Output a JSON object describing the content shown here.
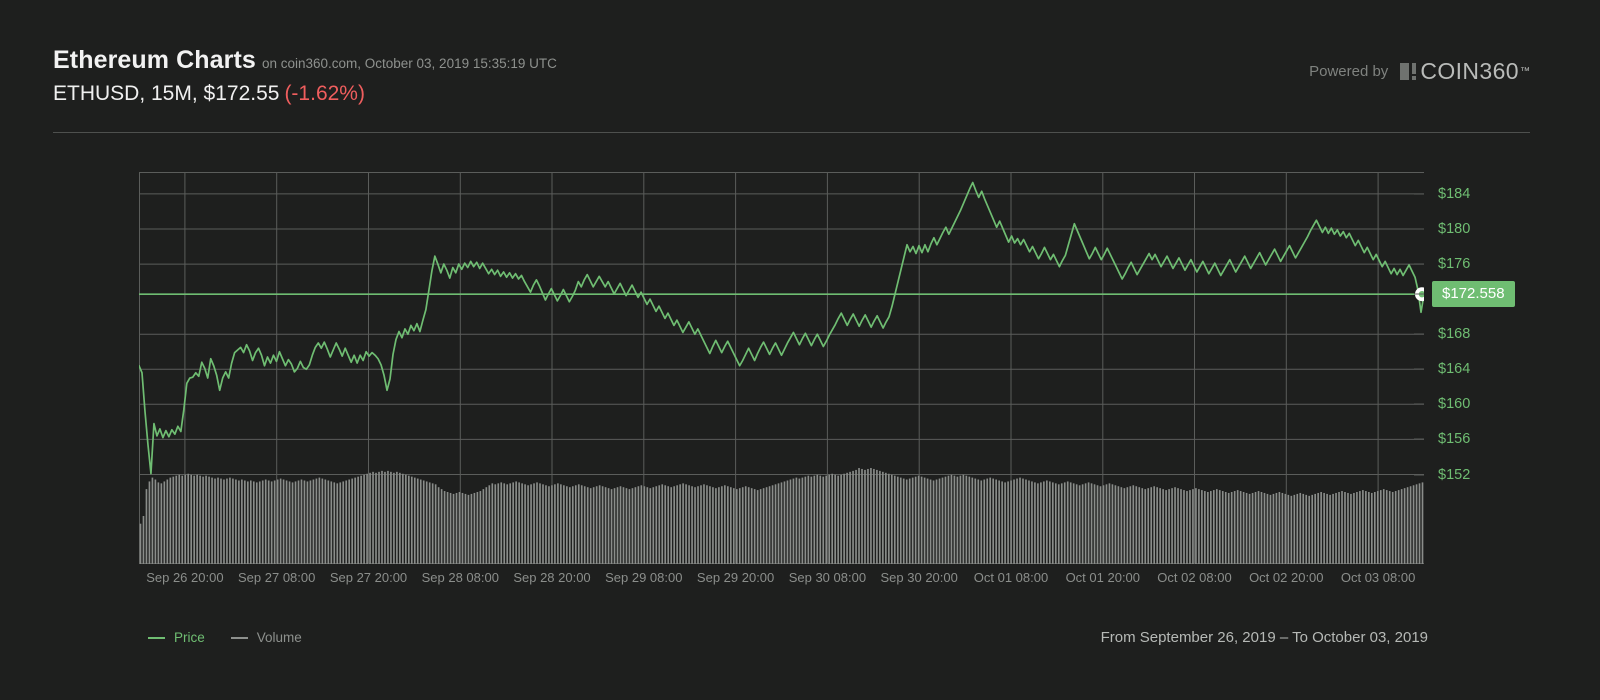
{
  "header": {
    "title": "Ethereum Charts",
    "source_line": "on coin360.com, October 03, 2019 15:35:19 UTC",
    "pair_line": "ETHUSD, 15M, $172.55",
    "change": "(-1.62%)",
    "powered_by": "Powered by",
    "brand": "COIN360",
    "brand_tm": "™"
  },
  "legend": {
    "price_label": "Price",
    "volume_label": "Volume",
    "price_color": "#6fbd72",
    "volume_color": "#8d908d"
  },
  "footer": {
    "range": "From September 26, 2019 – To October 03, 2019"
  },
  "colors": {
    "background": "#1e1f1e",
    "grid": "#5b5d5b",
    "price_line": "#6fbd72",
    "volume_bar": "#8a8d8a",
    "change_negative": "#ef5e5e",
    "axis_text": "#8b8e8b",
    "badge_bg": "#6fbd72",
    "badge_text": "#ffffff"
  },
  "chart_data": {
    "type": "line",
    "title": "Ethereum Charts",
    "subtitle": "ETHUSD, 15M, $172.55 (-1.62%)",
    "xlabel": "",
    "ylabel": "",
    "grid": true,
    "legend_position": "bottom-left",
    "ylim": [
      150,
      186.5
    ],
    "yticks": [
      184,
      180,
      176,
      172.558,
      168,
      164,
      160,
      156,
      152
    ],
    "ytick_labels": [
      "$184",
      "$180",
      "$176",
      "$172.558",
      "$168",
      "$164",
      "$160",
      "$156",
      "$152"
    ],
    "current_price_line": 172.558,
    "current_price_label": "$172.558",
    "xtick_labels": [
      "Sep 26 20:00",
      "Sep 27 08:00",
      "Sep 27 20:00",
      "Sep 28 08:00",
      "Sep 28 20:00",
      "Sep 29 08:00",
      "Sep 29 20:00",
      "Sep 30 08:00",
      "Sep 30 20:00",
      "Oct 01 08:00",
      "Oct 01 20:00",
      "Oct 02 08:00",
      "Oct 02 20:00",
      "Oct 03 08:00"
    ],
    "series": [
      {
        "name": "Price",
        "unit": "USD",
        "color": "#6fbd72",
        "values": [
          164.4,
          163.6,
          159.2,
          155.4,
          152.1,
          157.8,
          156.4,
          157.2,
          156.2,
          157.0,
          156.3,
          157.1,
          156.6,
          157.5,
          156.9,
          159.4,
          162.4,
          163.0,
          163.1,
          163.6,
          163.2,
          164.8,
          164.1,
          163.0,
          165.2,
          164.4,
          163.3,
          161.6,
          163.0,
          163.7,
          163.0,
          164.7,
          165.9,
          166.2,
          166.5,
          165.9,
          166.8,
          166.1,
          165.0,
          165.9,
          166.4,
          165.6,
          164.4,
          165.4,
          164.7,
          165.6,
          164.9,
          166.0,
          165.2,
          164.4,
          165.1,
          164.6,
          163.7,
          164.1,
          164.9,
          164.2,
          164.0,
          164.5,
          165.6,
          166.5,
          167.0,
          166.4,
          167.1,
          166.3,
          165.4,
          166.2,
          167.0,
          166.3,
          165.5,
          166.4,
          165.6,
          164.8,
          165.6,
          164.7,
          165.6,
          165.0,
          166.0,
          165.5,
          165.9,
          165.6,
          165.2,
          164.5,
          163.3,
          161.6,
          162.9,
          165.7,
          167.4,
          168.3,
          167.6,
          168.6,
          168.0,
          169.0,
          168.4,
          169.2,
          168.3,
          169.6,
          170.8,
          173.0,
          175.2,
          176.9,
          176.0,
          175.0,
          176.0,
          175.3,
          174.4,
          175.6,
          175.0,
          176.0,
          175.4,
          176.1,
          175.6,
          176.3,
          175.7,
          176.2,
          175.5,
          176.1,
          175.5,
          174.9,
          175.4,
          174.8,
          175.3,
          174.6,
          175.1,
          174.5,
          175.0,
          174.4,
          174.9,
          174.3,
          174.7,
          174.0,
          173.4,
          172.8,
          173.6,
          174.2,
          173.5,
          172.7,
          171.9,
          172.6,
          173.2,
          172.5,
          171.8,
          172.4,
          173.1,
          172.4,
          171.7,
          172.3,
          173.0,
          174.0,
          173.4,
          174.2,
          174.8,
          174.1,
          173.4,
          174.0,
          174.6,
          174.0,
          173.4,
          174.0,
          173.3,
          172.6,
          173.2,
          173.8,
          173.1,
          172.4,
          173.0,
          173.6,
          172.9,
          172.2,
          172.8,
          172.1,
          171.4,
          172.0,
          171.3,
          170.6,
          171.2,
          170.5,
          169.8,
          170.4,
          169.7,
          169.0,
          169.6,
          168.9,
          168.2,
          168.8,
          169.4,
          168.7,
          168.0,
          168.6,
          167.9,
          167.2,
          166.5,
          165.8,
          166.6,
          167.3,
          166.6,
          165.9,
          166.6,
          167.2,
          166.5,
          165.8,
          165.1,
          164.4,
          165.0,
          165.7,
          166.4,
          165.7,
          165.0,
          165.8,
          166.5,
          167.1,
          166.4,
          165.7,
          166.4,
          167.0,
          166.3,
          165.6,
          166.3,
          167.0,
          167.6,
          168.2,
          167.5,
          166.8,
          167.5,
          168.1,
          167.4,
          166.7,
          167.4,
          168.0,
          167.3,
          166.6,
          167.2,
          167.9,
          168.5,
          169.1,
          169.8,
          170.4,
          169.7,
          169.0,
          169.7,
          170.3,
          169.6,
          168.9,
          169.6,
          170.2,
          169.5,
          168.8,
          169.5,
          170.1,
          169.4,
          168.7,
          169.4,
          170.0,
          171.2,
          172.6,
          174.0,
          175.4,
          176.8,
          178.2,
          177.4,
          178.0,
          177.2,
          178.1,
          177.3,
          178.2,
          177.4,
          178.3,
          179.0,
          178.2,
          178.9,
          179.6,
          180.2,
          179.4,
          180.1,
          180.8,
          181.5,
          182.2,
          183.0,
          183.8,
          184.6,
          185.3,
          184.4,
          183.6,
          184.3,
          183.4,
          182.6,
          181.8,
          181.0,
          180.2,
          180.9,
          180.1,
          179.3,
          178.5,
          179.2,
          178.4,
          178.9,
          178.2,
          178.8,
          178.1,
          177.4,
          178.0,
          177.3,
          176.6,
          177.2,
          177.9,
          177.2,
          176.5,
          177.1,
          176.4,
          175.7,
          176.4,
          177.0,
          178.2,
          179.4,
          180.6,
          179.8,
          179.0,
          178.2,
          177.4,
          176.6,
          177.2,
          177.9,
          177.2,
          176.5,
          177.1,
          177.8,
          177.1,
          176.4,
          175.7,
          175.0,
          174.3,
          174.9,
          175.6,
          176.2,
          175.5,
          174.8,
          175.4,
          176.0,
          176.6,
          177.2,
          176.5,
          177.1,
          176.4,
          175.7,
          176.3,
          176.9,
          176.2,
          175.5,
          176.1,
          176.7,
          176.0,
          175.3,
          175.9,
          176.5,
          175.8,
          175.1,
          175.7,
          176.3,
          175.6,
          174.9,
          175.5,
          176.1,
          175.4,
          174.7,
          175.3,
          175.9,
          176.5,
          175.8,
          175.1,
          175.7,
          176.3,
          176.9,
          176.2,
          175.5,
          176.1,
          176.7,
          177.3,
          176.6,
          175.9,
          176.5,
          177.1,
          177.7,
          177.0,
          176.3,
          176.9,
          177.5,
          178.1,
          177.4,
          176.7,
          177.3,
          177.9,
          178.5,
          179.1,
          179.8,
          180.4,
          181.0,
          180.3,
          179.6,
          180.2,
          179.5,
          180.1,
          179.4,
          179.9,
          179.2,
          179.7,
          179.0,
          179.5,
          178.8,
          178.1,
          178.7,
          178.0,
          177.3,
          177.9,
          177.2,
          176.5,
          177.1,
          176.4,
          175.7,
          176.3,
          175.6,
          174.9,
          175.5,
          174.8,
          175.4,
          174.7,
          175.3,
          175.9,
          175.2,
          174.5,
          173.0,
          170.5,
          172.558
        ]
      },
      {
        "name": "Volume",
        "unit": "USD",
        "color": "#8a8d8a",
        "relative_heights": [
          0.42,
          0.5,
          0.78,
          0.86,
          0.9,
          0.88,
          0.85,
          0.84,
          0.86,
          0.88,
          0.9,
          0.91,
          0.92,
          0.93,
          0.92,
          0.93,
          0.94,
          0.93,
          0.92,
          0.93,
          0.92,
          0.91,
          0.92,
          0.91,
          0.9,
          0.89,
          0.9,
          0.89,
          0.88,
          0.89,
          0.9,
          0.89,
          0.88,
          0.87,
          0.88,
          0.87,
          0.86,
          0.87,
          0.86,
          0.85,
          0.86,
          0.87,
          0.88,
          0.87,
          0.86,
          0.87,
          0.88,
          0.89,
          0.88,
          0.87,
          0.86,
          0.85,
          0.86,
          0.87,
          0.88,
          0.87,
          0.86,
          0.87,
          0.88,
          0.89,
          0.9,
          0.89,
          0.88,
          0.87,
          0.86,
          0.85,
          0.84,
          0.85,
          0.86,
          0.87,
          0.88,
          0.89,
          0.9,
          0.91,
          0.92,
          0.93,
          0.94,
          0.95,
          0.96,
          0.95,
          0.96,
          0.97,
          0.96,
          0.97,
          0.96,
          0.95,
          0.96,
          0.95,
          0.94,
          0.93,
          0.92,
          0.91,
          0.9,
          0.89,
          0.88,
          0.87,
          0.86,
          0.85,
          0.84,
          0.83,
          0.8,
          0.78,
          0.76,
          0.75,
          0.74,
          0.73,
          0.74,
          0.75,
          0.74,
          0.73,
          0.72,
          0.73,
          0.74,
          0.75,
          0.76,
          0.78,
          0.8,
          0.82,
          0.84,
          0.83,
          0.84,
          0.85,
          0.84,
          0.83,
          0.84,
          0.85,
          0.86,
          0.85,
          0.84,
          0.83,
          0.82,
          0.83,
          0.84,
          0.85,
          0.84,
          0.83,
          0.82,
          0.81,
          0.82,
          0.83,
          0.84,
          0.83,
          0.82,
          0.81,
          0.8,
          0.81,
          0.82,
          0.83,
          0.82,
          0.81,
          0.8,
          0.79,
          0.8,
          0.81,
          0.82,
          0.81,
          0.8,
          0.79,
          0.78,
          0.79,
          0.8,
          0.81,
          0.8,
          0.79,
          0.78,
          0.79,
          0.8,
          0.81,
          0.82,
          0.81,
          0.8,
          0.79,
          0.8,
          0.81,
          0.82,
          0.83,
          0.82,
          0.81,
          0.8,
          0.81,
          0.82,
          0.83,
          0.84,
          0.83,
          0.82,
          0.81,
          0.8,
          0.81,
          0.82,
          0.83,
          0.82,
          0.81,
          0.8,
          0.79,
          0.8,
          0.81,
          0.82,
          0.81,
          0.8,
          0.79,
          0.78,
          0.79,
          0.8,
          0.81,
          0.8,
          0.79,
          0.78,
          0.77,
          0.78,
          0.79,
          0.8,
          0.81,
          0.82,
          0.83,
          0.84,
          0.85,
          0.86,
          0.87,
          0.88,
          0.89,
          0.9,
          0.89,
          0.9,
          0.91,
          0.92,
          0.91,
          0.92,
          0.93,
          0.92,
          0.91,
          0.92,
          0.93,
          0.94,
          0.93,
          0.92,
          0.93,
          0.94,
          0.95,
          0.96,
          0.97,
          0.98,
          1.0,
          0.99,
          0.98,
          0.99,
          1.0,
          0.99,
          0.98,
          0.97,
          0.96,
          0.95,
          0.94,
          0.93,
          0.92,
          0.91,
          0.9,
          0.89,
          0.88,
          0.89,
          0.9,
          0.91,
          0.92,
          0.91,
          0.9,
          0.89,
          0.88,
          0.87,
          0.88,
          0.89,
          0.9,
          0.91,
          0.92,
          0.93,
          0.92,
          0.91,
          0.92,
          0.93,
          0.92,
          0.91,
          0.9,
          0.89,
          0.88,
          0.87,
          0.88,
          0.89,
          0.9,
          0.89,
          0.88,
          0.87,
          0.86,
          0.85,
          0.86,
          0.87,
          0.88,
          0.89,
          0.9,
          0.89,
          0.88,
          0.87,
          0.86,
          0.85,
          0.84,
          0.85,
          0.86,
          0.87,
          0.86,
          0.85,
          0.84,
          0.83,
          0.84,
          0.85,
          0.86,
          0.85,
          0.84,
          0.83,
          0.82,
          0.83,
          0.84,
          0.85,
          0.84,
          0.83,
          0.82,
          0.81,
          0.82,
          0.83,
          0.84,
          0.83,
          0.82,
          0.81,
          0.8,
          0.79,
          0.8,
          0.81,
          0.82,
          0.81,
          0.8,
          0.79,
          0.78,
          0.79,
          0.8,
          0.81,
          0.8,
          0.79,
          0.78,
          0.77,
          0.78,
          0.79,
          0.8,
          0.79,
          0.78,
          0.77,
          0.76,
          0.77,
          0.78,
          0.79,
          0.78,
          0.77,
          0.76,
          0.75,
          0.76,
          0.77,
          0.78,
          0.77,
          0.76,
          0.75,
          0.74,
          0.75,
          0.76,
          0.77,
          0.76,
          0.75,
          0.74,
          0.73,
          0.74,
          0.75,
          0.76,
          0.75,
          0.74,
          0.73,
          0.72,
          0.73,
          0.74,
          0.75,
          0.74,
          0.73,
          0.72,
          0.71,
          0.72,
          0.73,
          0.74,
          0.73,
          0.72,
          0.71,
          0.72,
          0.73,
          0.74,
          0.75,
          0.74,
          0.73,
          0.72,
          0.73,
          0.74,
          0.75,
          0.76,
          0.75,
          0.74,
          0.73,
          0.74,
          0.75,
          0.76,
          0.77,
          0.76,
          0.75,
          0.74,
          0.75,
          0.76,
          0.77,
          0.78,
          0.77,
          0.76,
          0.75,
          0.76,
          0.77,
          0.78,
          0.79,
          0.8,
          0.81,
          0.82,
          0.83,
          0.84,
          0.85
        ]
      }
    ]
  }
}
